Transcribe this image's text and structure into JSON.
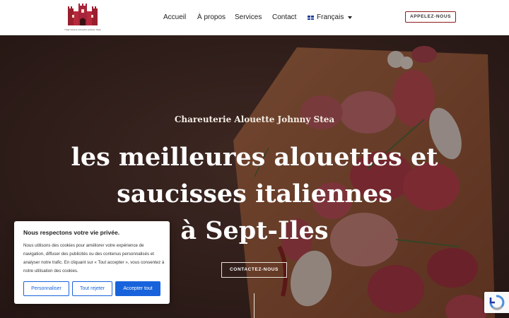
{
  "header": {
    "logo_caption": "Charcuterie Alouette Johnny Stea",
    "nav": [
      "Accueil",
      "À propos",
      "Services",
      "Contact"
    ],
    "language": "Français",
    "call_button": "APPELEZ-NOUS"
  },
  "hero": {
    "tagline": "Chareuterie Alouette Johnny Stea",
    "headline_line1": "les meilleures alouettes et",
    "headline_line2": "saucisses italiennes",
    "headline_line3": "à Sept-Iles",
    "contact_button": "CONTACTEZ-NOUS"
  },
  "cookie_banner": {
    "title": "Nous respectons votre vie privée.",
    "text": "Nous utilisons des cookies pour améliorer votre expérience de navigation, diffuser des publicités ou des contenus personnalisés et analyser notre trafic. En cliquant sur « Tout accepter », vous consentez à notre utilisation des cookies.",
    "customize": "Personnaliser",
    "reject": "Tout rejeter",
    "accept": "Accepter tout"
  },
  "colors": {
    "accent": "#1863dc",
    "brand": "#8a1c1c"
  },
  "icons": [
    "castle-logo-icon",
    "france-flag-icon",
    "chevron-down-icon",
    "recaptcha-icon"
  ]
}
